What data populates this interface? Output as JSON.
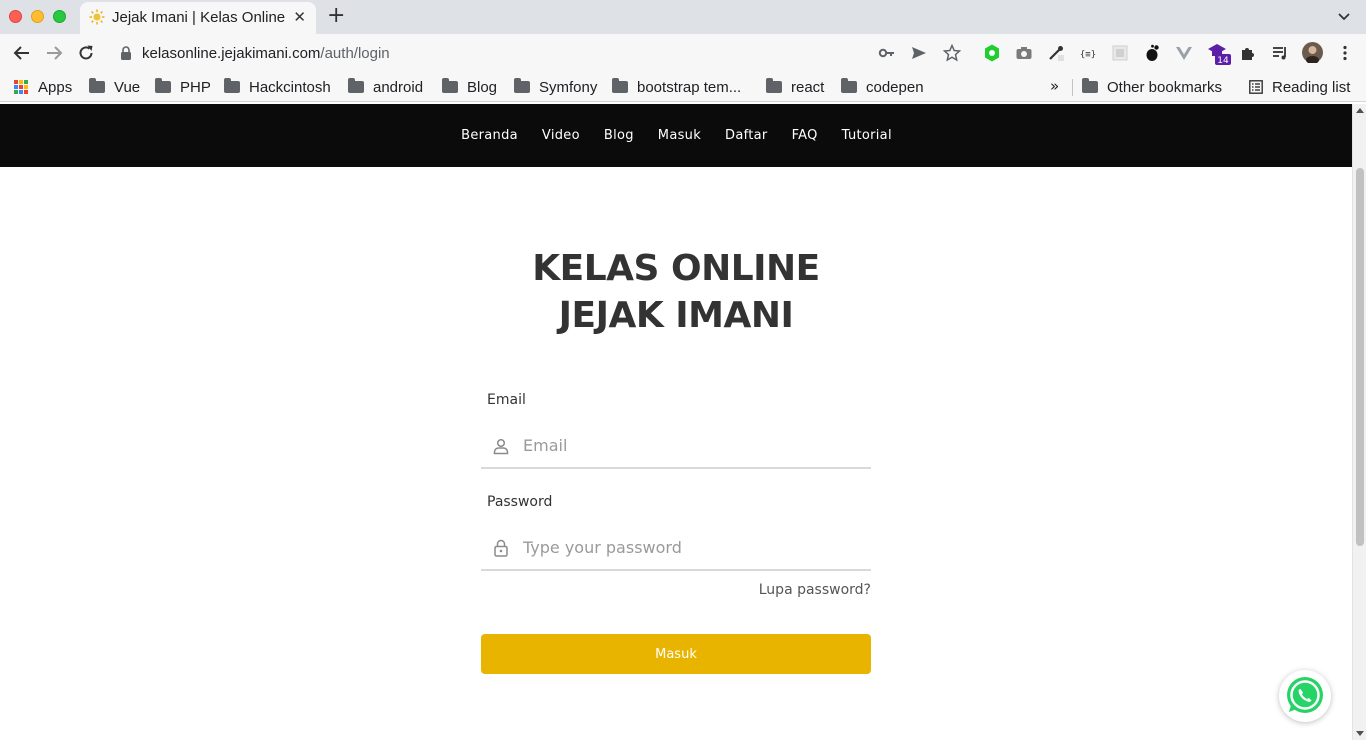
{
  "browser": {
    "tab_title": "Jejak Imani | Kelas Online",
    "tab_close": "✕",
    "new_tab": "+",
    "url_host": "kelasonline.jejakimani.com",
    "url_path": "/auth/login",
    "extension_badge": "14"
  },
  "bookmarks": {
    "apps": "Apps",
    "folders": [
      "Vue",
      "PHP",
      "Hackcintosh",
      "android",
      "Blog",
      "Symfony",
      "bootstrap tem...",
      "react",
      "codepen"
    ],
    "more": "»",
    "other": "Other bookmarks",
    "reading_list": "Reading list"
  },
  "site_nav": {
    "items": [
      "Beranda",
      "Video",
      "Blog",
      "Masuk",
      "Daftar",
      "FAQ",
      "Tutorial"
    ]
  },
  "heading": {
    "line1": "KELAS ONLINE",
    "line2": "JEJAK IMANI"
  },
  "form": {
    "email_label": "Email",
    "email_placeholder": "Email",
    "password_label": "Password",
    "password_placeholder": "Type your password",
    "forgot": "Lupa password?",
    "submit": "Masuk"
  },
  "colors": {
    "nav_bg": "#0b0b0b",
    "button": "#e9b400",
    "whatsapp": "#25d366"
  }
}
